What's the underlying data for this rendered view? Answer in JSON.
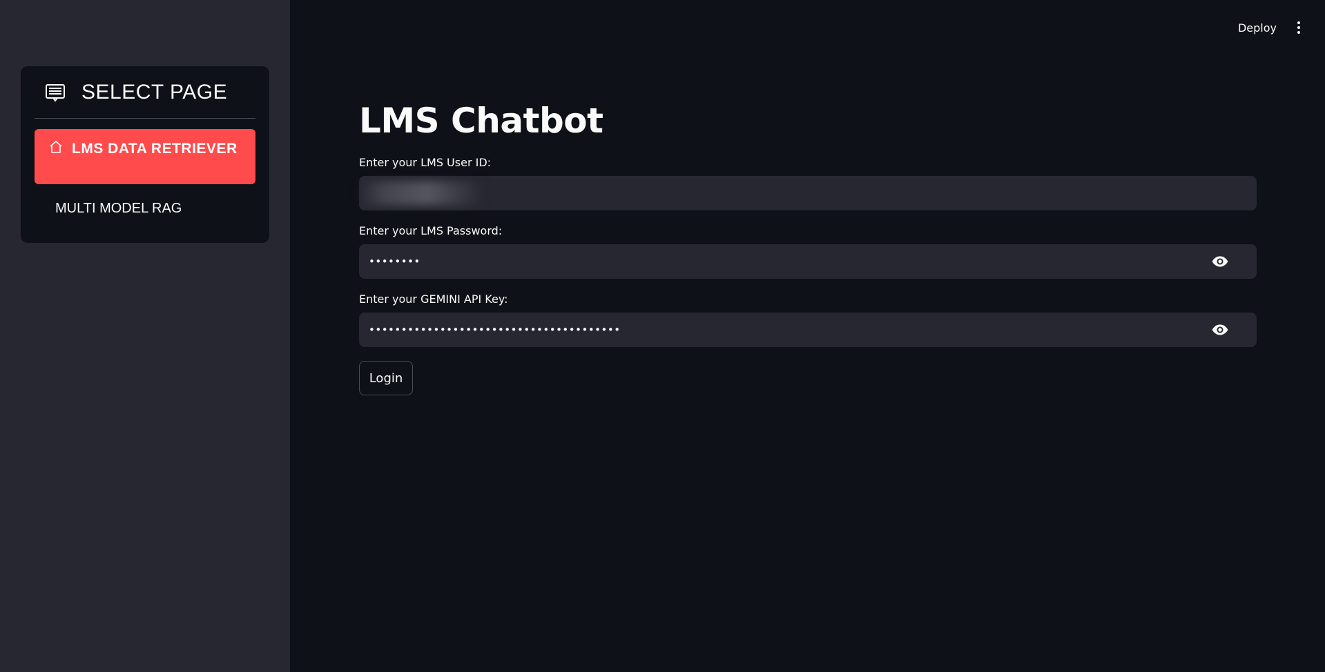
{
  "sidebar": {
    "menu_title": "SELECT PAGE",
    "menu_icon": "menu-list-icon",
    "items": [
      {
        "label": "LMS DATA RETRIEVER",
        "icon": "home-icon",
        "active": true
      },
      {
        "label": "MULTI MODEL RAG",
        "active": false
      }
    ]
  },
  "topbar": {
    "deploy_label": "Deploy",
    "menu_icon": "kebab-menu-icon"
  },
  "main": {
    "title": "LMS Chatbot",
    "user_id": {
      "label": "Enter your LMS User ID:",
      "value": ""
    },
    "password": {
      "label": "Enter your LMS Password:",
      "value": "••••••••"
    },
    "api_key": {
      "label": "Enter your GEMINI API Key:",
      "value": "•••••••••••••••••••••••••••••••••••••••"
    },
    "login_label": "Login"
  },
  "colors": {
    "sidebar_bg": "#262730",
    "main_bg": "#0e1117",
    "accent": "#ff4b4b",
    "input_bg": "#262730"
  }
}
